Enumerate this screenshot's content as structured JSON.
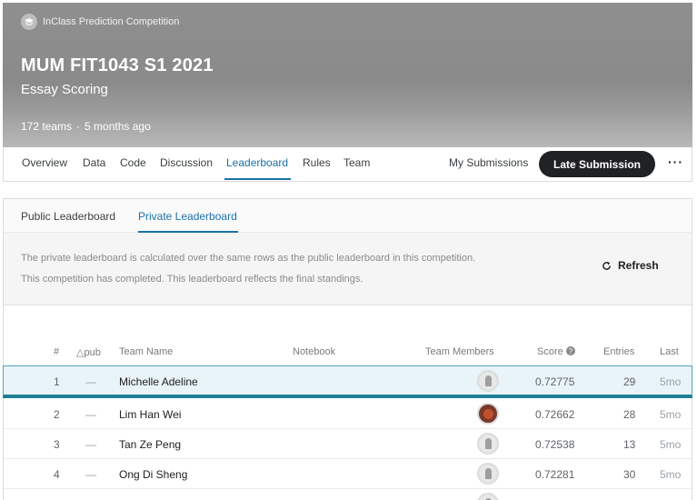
{
  "header": {
    "competition_type": "InClass Prediction Competition",
    "title": "MUM FIT1043 S1 2021",
    "subtitle": "Essay Scoring",
    "teams": "172 teams",
    "separator": "·",
    "time_ago": "5 months ago",
    "icon": "graduation-cap-icon"
  },
  "nav": {
    "tabs": [
      "Overview",
      "Data",
      "Code",
      "Discussion",
      "Leaderboard",
      "Rules",
      "Team"
    ],
    "active_tab": "Leaderboard",
    "my_submissions": "My Submissions",
    "late_submission": "Late Submission",
    "more": "···"
  },
  "leaderboard": {
    "tabs": [
      "Public Leaderboard",
      "Private Leaderboard"
    ],
    "active_tab": "Private Leaderboard",
    "info_line_1": "The private leaderboard is calculated over the same rows as the public leaderboard in this competition.",
    "info_line_2": "This competition has completed. This leaderboard reflects the final standings.",
    "refresh_label": "Refresh",
    "columns": [
      "#",
      "△pub",
      "Team Name",
      "Notebook",
      "Team Members",
      "Score",
      "Entries",
      "Last"
    ],
    "rows": [
      {
        "rank": "1",
        "pub": "—",
        "team": "Michelle Adeline",
        "score": "0.72775",
        "entries": "29",
        "last": "5mo",
        "highlight": true
      },
      {
        "rank": "2",
        "pub": "—",
        "team": "Lim Han Wei",
        "score": "0.72662",
        "entries": "28",
        "last": "5mo",
        "highlight": false
      },
      {
        "rank": "3",
        "pub": "—",
        "team": "Tan Ze Peng",
        "score": "0.72538",
        "entries": "13",
        "last": "5mo",
        "highlight": false
      },
      {
        "rank": "4",
        "pub": "—",
        "team": "Ong Di Sheng",
        "score": "0.72281",
        "entries": "30",
        "last": "5mo",
        "highlight": false
      }
    ]
  },
  "colors": {
    "accent": "#1a73a8",
    "dark_button": "#202124",
    "highlight_row": "#e9f4f8",
    "highlight_border": "#1f7f96"
  }
}
